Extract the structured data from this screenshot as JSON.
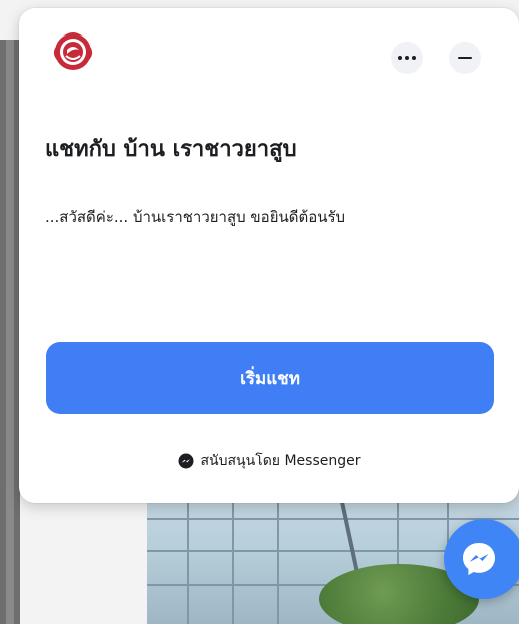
{
  "chat": {
    "title": "แชทกับ บ้าน เราชาวยาสูบ",
    "greeting": "...สวัสดีค่ะ... บ้านเราชาวยาสูบ ขอยินดีต้อนรับ",
    "start_button_label": "เริ่มแชท",
    "powered_by": "สนับสนุนโดย Messenger"
  },
  "icons": {
    "logo": "page-logo-seal",
    "more": "more-options-icon",
    "minimize": "minimize-icon",
    "messenger": "messenger-icon",
    "fab": "messenger-launcher-icon"
  },
  "colors": {
    "accent": "#3f7ef5",
    "fab": "#3f85f5",
    "text": "#1c1e21",
    "icon_button_bg": "#f0f2f5",
    "logo_red": "#c62b3a"
  }
}
